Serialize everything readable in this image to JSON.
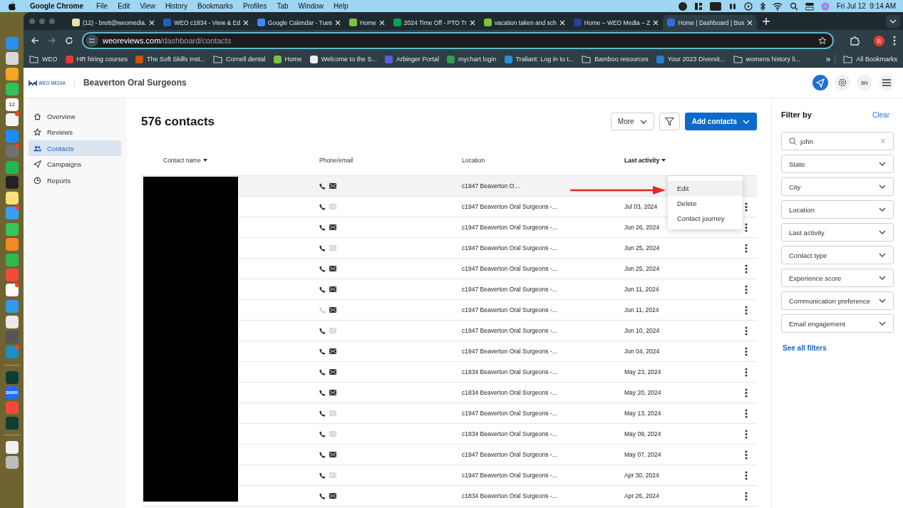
{
  "menubar": {
    "app": "Google Chrome",
    "menus": [
      "File",
      "Edit",
      "View",
      "History",
      "Bookmarks",
      "Profiles",
      "Tab",
      "Window",
      "Help"
    ],
    "date": "Fri Jul 12",
    "time": "9:14 AM"
  },
  "dock": [
    [
      {
        "color": "#2d8cf0",
        "badge": false
      },
      {
        "color": "#d9d9d9",
        "badge": false
      },
      {
        "color": "#f5a623",
        "badge": false
      },
      {
        "color": "#2fc25b",
        "badge": false
      },
      {
        "color": "#ffffff",
        "badge": false,
        "label": "12"
      },
      {
        "color": "#f4f4f4",
        "badge": true
      },
      {
        "color": "#1a8cff",
        "badge": false
      },
      {
        "color": "#707070",
        "badge": true
      },
      {
        "color": "#1db954",
        "badge": false
      },
      {
        "color": "#222222",
        "badge": false
      },
      {
        "color": "#f7e27a",
        "badge": false
      },
      {
        "color": "#3a9cf2",
        "badge": true
      },
      {
        "color": "#34c759",
        "badge": false
      },
      {
        "color": "#f08a24",
        "badge": false
      },
      {
        "color": "#30b94d",
        "badge": false
      },
      {
        "color": "#f04a3a",
        "badge": false
      },
      {
        "color": "#fafafa",
        "badge": true
      },
      {
        "color": "#2f9ae8",
        "badge": false
      },
      {
        "color": "#e9e9e9",
        "badge": false
      },
      {
        "color": "#555555",
        "badge": false
      },
      {
        "color": "#1b8fbf",
        "badge": true
      }
    ],
    [
      {
        "color": "#0f3d33",
        "badge": false
      },
      {
        "color": "#1f6dff",
        "badge": false,
        "label": "zoom"
      },
      {
        "color": "#f04a3a",
        "badge": false
      },
      {
        "color": "#0f3d33",
        "badge": false
      }
    ],
    [
      {
        "color": "#f1f1f1",
        "badge": false
      },
      {
        "color": "#bbbbbb",
        "badge": false
      }
    ]
  ],
  "browser": {
    "tabs": [
      {
        "title": "(12) - brett@weomedia.",
        "color": "#e8e0b0",
        "selected": false
      },
      {
        "title": "WEO c1834 - View & Ed",
        "color": "#1e5fb4",
        "selected": false
      },
      {
        "title": "Google Calendar - Tues",
        "color": "#4285f4",
        "selected": false
      },
      {
        "title": "Home",
        "color": "#7cc142",
        "selected": false
      },
      {
        "title": "2024 Time Off - PTO Tr",
        "color": "#0f9d58",
        "selected": false
      },
      {
        "title": "vacation taken and sch",
        "color": "#7cc142",
        "selected": false
      },
      {
        "title": "Home – WEO Media – Z",
        "color": "#2a3f9a",
        "selected": false
      },
      {
        "title": "Home | Dashboard | Bus",
        "color": "#2f6fd8",
        "selected": true
      }
    ],
    "address": {
      "host": "weoreviews.com",
      "path": "/dashboard/contacts"
    },
    "profile": "B",
    "bookmarks": [
      {
        "label": "WEO",
        "kind": "folder"
      },
      {
        "label": "HR hiring courses",
        "kind": "site",
        "color": "#e53935"
      },
      {
        "label": "The Soft Skills Inst...",
        "kind": "site",
        "color": "#d35400"
      },
      {
        "label": "Cornell dental",
        "kind": "folder"
      },
      {
        "label": "Home",
        "kind": "site",
        "color": "#7cc142"
      },
      {
        "label": "Welcome to the S...",
        "kind": "site",
        "color": "#eeeeee"
      },
      {
        "label": "Arbinger Portal",
        "kind": "site",
        "color": "#5b5fe0"
      },
      {
        "label": "mychart login",
        "kind": "site",
        "color": "#2e9d4f"
      },
      {
        "label": "Traliant: Log in to t...",
        "kind": "site",
        "color": "#2b8fd6"
      },
      {
        "label": "Bamboo resources",
        "kind": "folder"
      },
      {
        "label": "Your 2023 Diversit...",
        "kind": "site",
        "color": "#2b7bd6"
      },
      {
        "label": "womens history li...",
        "kind": "folder"
      }
    ],
    "overflow": "»",
    "all_bookmarks": "All Bookmarks"
  },
  "app": {
    "logo": "WEO MEDIA",
    "practice": "Beaverton Oral Surgeons",
    "avatar": "BN",
    "sidebar": [
      {
        "label": "Overview",
        "selected": false
      },
      {
        "label": "Reviews",
        "selected": false
      },
      {
        "label": "Contacts",
        "selected": true
      },
      {
        "label": "Campaigns",
        "selected": false
      },
      {
        "label": "Reports",
        "selected": false
      }
    ],
    "title": "576 contacts",
    "more": "More",
    "add": "Add contacts",
    "columns": [
      {
        "label": "Contact name",
        "sort": true,
        "active": false
      },
      {
        "label": "Phone/email",
        "sort": false,
        "active": false
      },
      {
        "label": "Location",
        "sort": false,
        "active": false
      },
      {
        "label": "Last activity",
        "sort": true,
        "active": true
      }
    ],
    "rows": [
      {
        "phone": true,
        "email": true,
        "location": "c1947 Beaverton O…",
        "selected": true
      },
      {
        "phone": true,
        "email": false,
        "location": "c1947 Beaverton Oral Surgeons -...",
        "date": "Jul 03, 2024",
        "selected": false
      },
      {
        "phone": true,
        "email": true,
        "location": "c1947 Beaverton Oral Surgeons -...",
        "date": "Jun 26, 2024",
        "selected": false
      },
      {
        "phone": true,
        "email": false,
        "location": "c1947 Beaverton Oral Surgeons -...",
        "date": "Jun 25, 2024",
        "selected": false
      },
      {
        "phone": true,
        "email": true,
        "location": "c1947 Beaverton Oral Surgeons -...",
        "date": "Jun 25, 2024",
        "selected": false
      },
      {
        "phone": true,
        "email": true,
        "location": "c1947 Beaverton Oral Surgeons -...",
        "date": "Jun 11, 2024",
        "selected": false
      },
      {
        "phone": false,
        "email": true,
        "location": "c1947 Beaverton Oral Surgeons -...",
        "date": "Jun 11, 2024",
        "selected": false
      },
      {
        "phone": true,
        "email": false,
        "location": "c1947 Beaverton Oral Surgeons -...",
        "date": "Jun 10, 2024",
        "selected": false
      },
      {
        "phone": true,
        "email": true,
        "location": "c1947 Beaverton Oral Surgeons -...",
        "date": "Jun 04, 2024",
        "selected": false
      },
      {
        "phone": true,
        "email": true,
        "location": "c1834 Beaverton Oral Surgeons -...",
        "date": "May 23, 2024",
        "selected": false
      },
      {
        "phone": true,
        "email": true,
        "location": "c1834 Beaverton Oral Surgeons -...",
        "date": "May 20, 2024",
        "selected": false
      },
      {
        "phone": true,
        "email": false,
        "location": "c1947 Beaverton Oral Surgeons -...",
        "date": "May 13, 2024",
        "selected": false
      },
      {
        "phone": true,
        "email": false,
        "location": "c1834 Beaverton Oral Surgeons -...",
        "date": "May 09, 2024",
        "selected": false
      },
      {
        "phone": true,
        "email": true,
        "location": "c1947 Beaverton Oral Surgeons -...",
        "date": "May 07, 2024",
        "selected": false
      },
      {
        "phone": true,
        "email": false,
        "location": "c1947 Beaverton Oral Surgeons -...",
        "date": "Apr 30, 2024",
        "selected": false
      },
      {
        "phone": true,
        "email": true,
        "location": "c1834 Beaverton Oral Surgeons -...",
        "date": "Apr 26, 2024",
        "selected": false
      }
    ],
    "menu": [
      {
        "label": "Edit",
        "selected": true
      },
      {
        "label": "Delete",
        "selected": false
      },
      {
        "label": "Contact journey",
        "selected": false
      }
    ],
    "filters": {
      "title": "Filter by",
      "clear": "Clear",
      "search": {
        "value": "john"
      },
      "dropdowns": [
        "State",
        "City",
        "Location",
        "Last activity",
        "Contact type",
        "Experience score",
        "Communication preference",
        "Email engagement"
      ],
      "see_all": "See all filters"
    }
  }
}
